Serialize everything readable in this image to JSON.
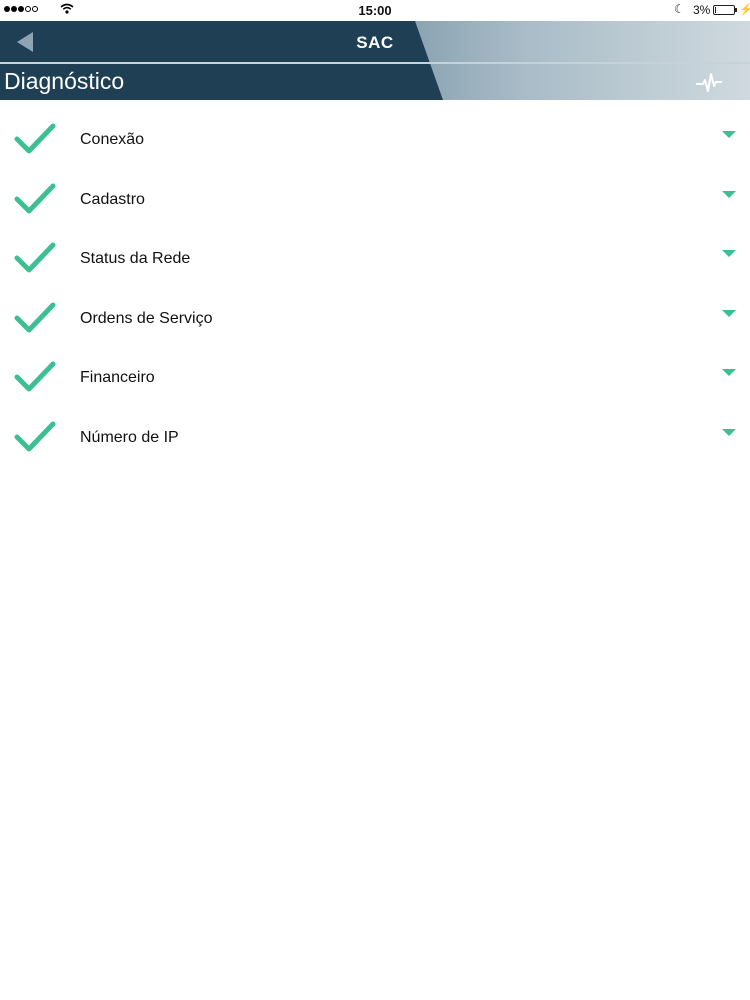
{
  "status_bar": {
    "time": "15:00",
    "battery": "3%",
    "battery_level": 0.03
  },
  "header": {
    "title": "SAC",
    "page_title": "Diagnóstico",
    "colors": {
      "primary": "#1f3f55",
      "accent": "#3cc092"
    }
  },
  "icons": {
    "back": "back-arrow-icon",
    "pulse": "heartbeat-icon",
    "status": "checkmark-icon",
    "expand": "chevron-down-icon"
  },
  "diagnostics": [
    {
      "label": "Conexão"
    },
    {
      "label": "Cadastro"
    },
    {
      "label": "Status da Rede"
    },
    {
      "label": "Ordens de Serviço"
    },
    {
      "label": "Financeiro"
    },
    {
      "label": "Número de IP"
    }
  ]
}
